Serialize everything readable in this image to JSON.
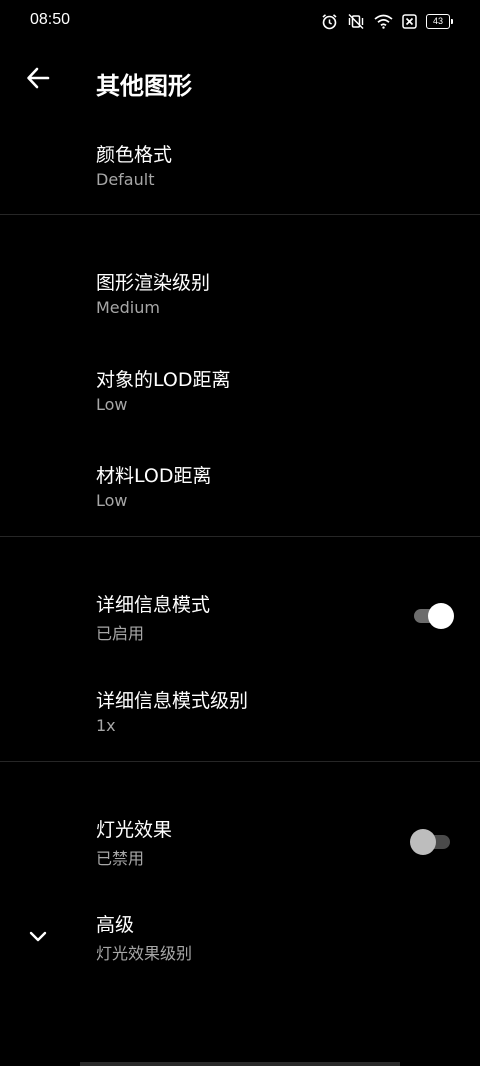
{
  "status_bar": {
    "time": "08:50",
    "battery": "43",
    "icons": [
      "alarm-icon",
      "vibrate-off-icon",
      "wifi-icon",
      "sim-disabled-icon",
      "battery-icon"
    ]
  },
  "app_bar": {
    "title": "其他图形",
    "back_icon": "arrow-back-icon"
  },
  "colors": {
    "background": "#000000",
    "title_text": "#ffffff",
    "summary_text": "#a7a7a7",
    "divider": "#262626"
  },
  "items": {
    "color_format": {
      "title": "颜色格式",
      "summary": "Default"
    },
    "render_level": {
      "title": "图形渲染级别",
      "summary": "Medium"
    },
    "object_lod": {
      "title": "对象的LOD距离",
      "summary": "Low"
    },
    "material_lod": {
      "title": "材料LOD距离",
      "summary": "Low"
    },
    "detail_mode": {
      "title": "详细信息模式",
      "summary": "已启用",
      "toggle": true
    },
    "detail_level": {
      "title": "详细信息模式级别",
      "summary": "1x"
    },
    "light_effects": {
      "title": "灯光效果",
      "summary": "已禁用",
      "toggle": false
    },
    "advanced": {
      "title": "高级",
      "summary": "灯光效果级别",
      "icon": "chevron-down-icon"
    }
  }
}
